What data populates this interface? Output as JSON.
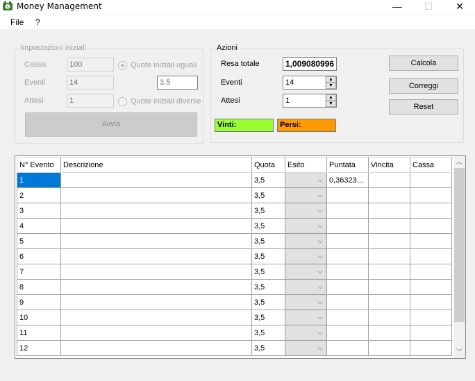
{
  "window": {
    "title": "Money Management",
    "min": "—",
    "max": "☐",
    "close": "✕"
  },
  "menu": {
    "file": "File",
    "help": "?"
  },
  "settings": {
    "legend": "Impostazioni iniziali",
    "cassa_label": "Cassa",
    "cassa_value": "100",
    "eventi_label": "Eventi",
    "eventi_value": "14",
    "attesi_label": "Attesi",
    "attesi_value": "1",
    "radio_uguali": "Quote iniziali uguali",
    "radio_diverse": "Quote iniziali diverse",
    "quota_value": "3.5",
    "avvia_label": "Avvia"
  },
  "actions": {
    "legend": "Azioni",
    "resa_label": "Resa totale",
    "resa_value": "1,009080996",
    "eventi_label": "Eventi",
    "eventi_value": "14",
    "attesi_label": "Attesi",
    "attesi_value": "1",
    "vinti_label": "Vinti:",
    "persi_label": "Persi:",
    "vinti_color": "#99ff33",
    "persi_color": "#ff9900",
    "calcola": "Calcola",
    "correggi": "Correggi",
    "reset": "Reset"
  },
  "grid": {
    "columns": [
      "N° Evento",
      "Descrizione",
      "Quota",
      "Esito",
      "Puntata",
      "Vincita",
      "Cassa"
    ],
    "rows": [
      {
        "n": "1",
        "descrizione": "",
        "quota": "3,5",
        "puntata": "0,36323...",
        "vincita": "",
        "cassa": ""
      },
      {
        "n": "2",
        "descrizione": "",
        "quota": "3,5",
        "puntata": "",
        "vincita": "",
        "cassa": ""
      },
      {
        "n": "3",
        "descrizione": "",
        "quota": "3,5",
        "puntata": "",
        "vincita": "",
        "cassa": ""
      },
      {
        "n": "4",
        "descrizione": "",
        "quota": "3,5",
        "puntata": "",
        "vincita": "",
        "cassa": ""
      },
      {
        "n": "5",
        "descrizione": "",
        "quota": "3,5",
        "puntata": "",
        "vincita": "",
        "cassa": ""
      },
      {
        "n": "6",
        "descrizione": "",
        "quota": "3,5",
        "puntata": "",
        "vincita": "",
        "cassa": ""
      },
      {
        "n": "7",
        "descrizione": "",
        "quota": "3,5",
        "puntata": "",
        "vincita": "",
        "cassa": ""
      },
      {
        "n": "8",
        "descrizione": "",
        "quota": "3,5",
        "puntata": "",
        "vincita": "",
        "cassa": ""
      },
      {
        "n": "9",
        "descrizione": "",
        "quota": "3,5",
        "puntata": "",
        "vincita": "",
        "cassa": ""
      },
      {
        "n": "10",
        "descrizione": "",
        "quota": "3,5",
        "puntata": "",
        "vincita": "",
        "cassa": ""
      },
      {
        "n": "11",
        "descrizione": "",
        "quota": "3,5",
        "puntata": "",
        "vincita": "",
        "cassa": ""
      },
      {
        "n": "12",
        "descrizione": "",
        "quota": "3,5",
        "puntata": "",
        "vincita": "",
        "cassa": ""
      }
    ]
  }
}
